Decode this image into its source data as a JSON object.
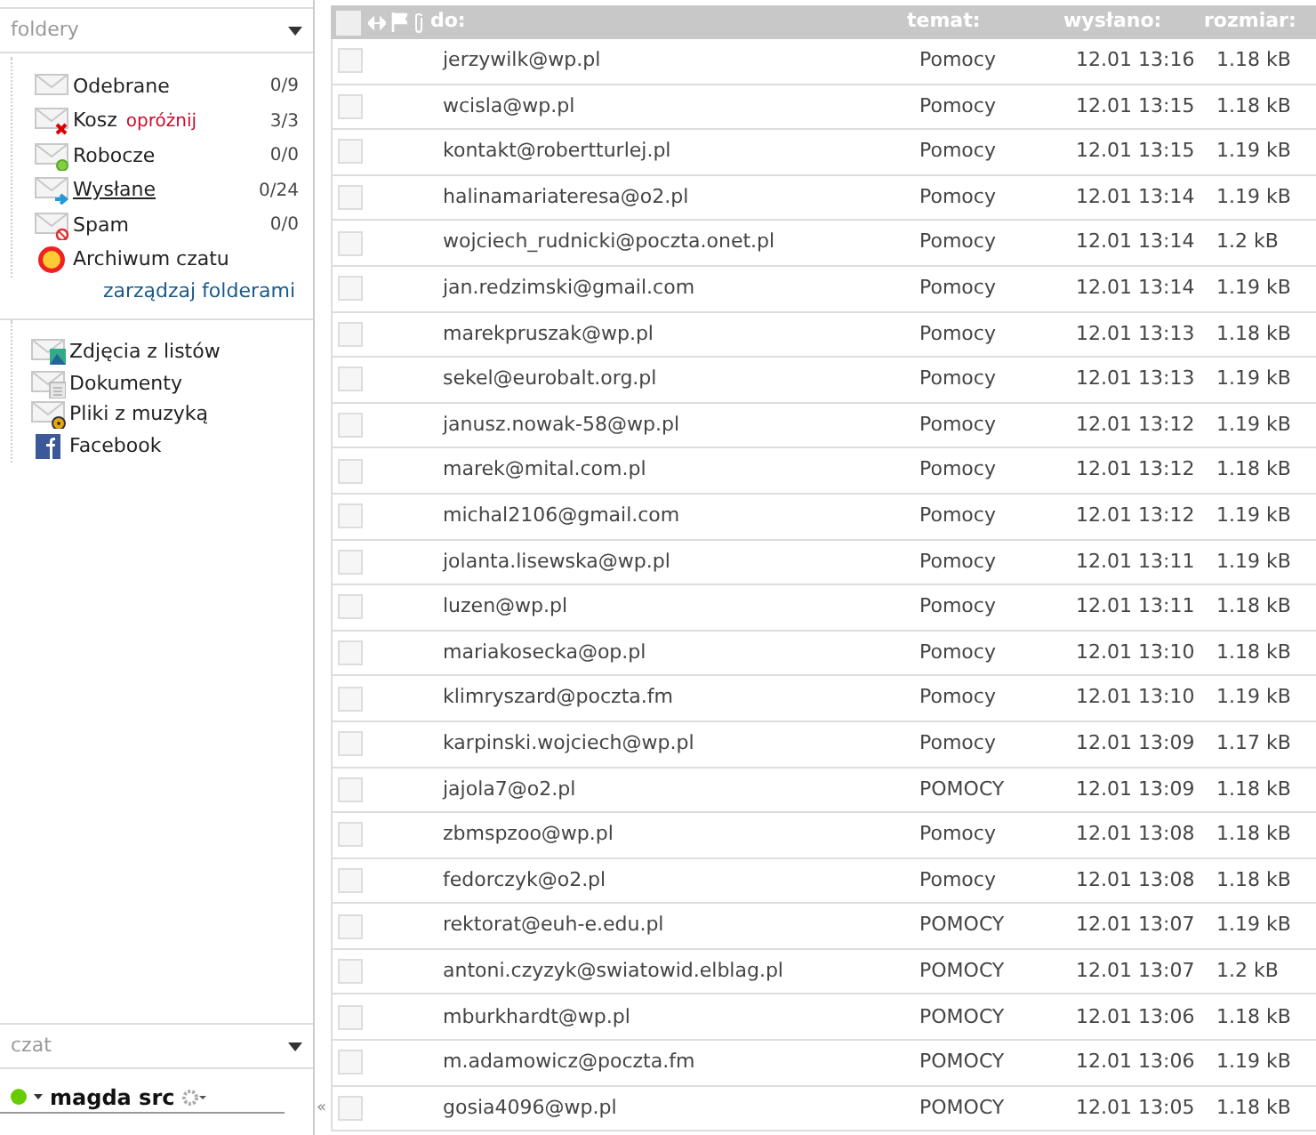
{
  "folders_panel": {
    "title": "foldery",
    "folders": [
      {
        "name": "Odebrane",
        "count": "0/9",
        "kind": "inbox",
        "underlined": false
      },
      {
        "name": "Kosz",
        "action": "opróżnij",
        "count": "3/3",
        "kind": "trash",
        "underlined": false
      },
      {
        "name": "Robocze",
        "count": "0/0",
        "kind": "drafts",
        "underlined": false
      },
      {
        "name": "Wysłane",
        "count": "0/24",
        "kind": "sent",
        "underlined": true
      },
      {
        "name": "Spam",
        "count": "0/0",
        "kind": "spam",
        "underlined": false
      },
      {
        "name": "Archiwum czatu",
        "kind": "chat",
        "underlined": false
      }
    ],
    "manage_link": "zarządzaj folderami",
    "extra_folders": [
      {
        "name": "Zdjęcia z listów",
        "kind": "photos"
      },
      {
        "name": "Dokumenty",
        "kind": "documents"
      },
      {
        "name": "Pliki z muzyką",
        "kind": "music"
      },
      {
        "name": "Facebook",
        "kind": "facebook"
      }
    ]
  },
  "chat_panel": {
    "title": "czat",
    "user": "magda src",
    "online": true
  },
  "collapse_button": "«",
  "table": {
    "all_checked": false,
    "columns": [
      "do:",
      "temat:",
      "wysłano:",
      "rozmiar:"
    ],
    "rows": [
      {
        "to": "jerzywilk@wp.pl",
        "subject": "Pomocy",
        "sent": "12.01 13:16",
        "size": "1.18 kB",
        "checked": false
      },
      {
        "to": "wcisla@wp.pl",
        "subject": "Pomocy",
        "sent": "12.01 13:15",
        "size": "1.18 kB",
        "checked": false
      },
      {
        "to": "kontakt@robertturlej.pl",
        "subject": "Pomocy",
        "sent": "12.01 13:15",
        "size": "1.19 kB",
        "checked": false
      },
      {
        "to": "halinamariateresa@o2.pl",
        "subject": "Pomocy",
        "sent": "12.01 13:14",
        "size": "1.19 kB",
        "checked": false
      },
      {
        "to": "wojciech_rudnicki@poczta.onet.pl",
        "subject": "Pomocy",
        "sent": "12.01 13:14",
        "size": "1.2 kB",
        "checked": false
      },
      {
        "to": "jan.redzimski@gmail.com",
        "subject": "Pomocy",
        "sent": "12.01 13:14",
        "size": "1.19 kB",
        "checked": false
      },
      {
        "to": "marekpruszak@wp.pl",
        "subject": "Pomocy",
        "sent": "12.01 13:13",
        "size": "1.18 kB",
        "checked": false
      },
      {
        "to": "sekel@eurobalt.org.pl",
        "subject": "Pomocy",
        "sent": "12.01 13:13",
        "size": "1.19 kB",
        "checked": false
      },
      {
        "to": "janusz.nowak-58@wp.pl",
        "subject": "Pomocy",
        "sent": "12.01 13:12",
        "size": "1.19 kB",
        "checked": false
      },
      {
        "to": "marek@mital.com.pl",
        "subject": "Pomocy",
        "sent": "12.01 13:12",
        "size": "1.18 kB",
        "checked": false
      },
      {
        "to": "michal2106@gmail.com",
        "subject": "Pomocy",
        "sent": "12.01 13:12",
        "size": "1.19 kB",
        "checked": false
      },
      {
        "to": "jolanta.lisewska@wp.pl",
        "subject": "Pomocy",
        "sent": "12.01 13:11",
        "size": "1.19 kB",
        "checked": false
      },
      {
        "to": "luzen@wp.pl",
        "subject": "Pomocy",
        "sent": "12.01 13:11",
        "size": "1.18 kB",
        "checked": false
      },
      {
        "to": "mariakosecka@op.pl",
        "subject": "Pomocy",
        "sent": "12.01 13:10",
        "size": "1.18 kB",
        "checked": false
      },
      {
        "to": "klimryszard@poczta.fm",
        "subject": "Pomocy",
        "sent": "12.01 13:10",
        "size": "1.19 kB",
        "checked": false
      },
      {
        "to": "karpinski.wojciech@wp.pl",
        "subject": "Pomocy",
        "sent": "12.01 13:09",
        "size": "1.17 kB",
        "checked": false
      },
      {
        "to": "jajola7@o2.pl",
        "subject": "POMOCY",
        "sent": "12.01 13:09",
        "size": "1.18 kB",
        "checked": false
      },
      {
        "to": "zbmspzoo@wp.pl",
        "subject": "Pomocy",
        "sent": "12.01 13:08",
        "size": "1.18 kB",
        "checked": false
      },
      {
        "to": "fedorczyk@o2.pl",
        "subject": "Pomocy",
        "sent": "12.01 13:08",
        "size": "1.18 kB",
        "checked": false
      },
      {
        "to": "rektorat@euh-e.edu.pl",
        "subject": "POMOCY",
        "sent": "12.01 13:07",
        "size": "1.19 kB",
        "checked": false
      },
      {
        "to": "antoni.czyzyk@swiatowid.elblag.pl",
        "subject": "POMOCY",
        "sent": "12.01 13:07",
        "size": "1.2 kB",
        "checked": false
      },
      {
        "to": "mburkhardt@wp.pl",
        "subject": "POMOCY",
        "sent": "12.01 13:06",
        "size": "1.18 kB",
        "checked": false
      },
      {
        "to": "m.adamowicz@poczta.fm",
        "subject": "POMOCY",
        "sent": "12.01 13:06",
        "size": "1.19 kB",
        "checked": false
      },
      {
        "to": "gosia4096@wp.pl",
        "subject": "POMOCY",
        "sent": "12.01 13:05",
        "size": "1.18 kB",
        "checked": false
      }
    ]
  }
}
